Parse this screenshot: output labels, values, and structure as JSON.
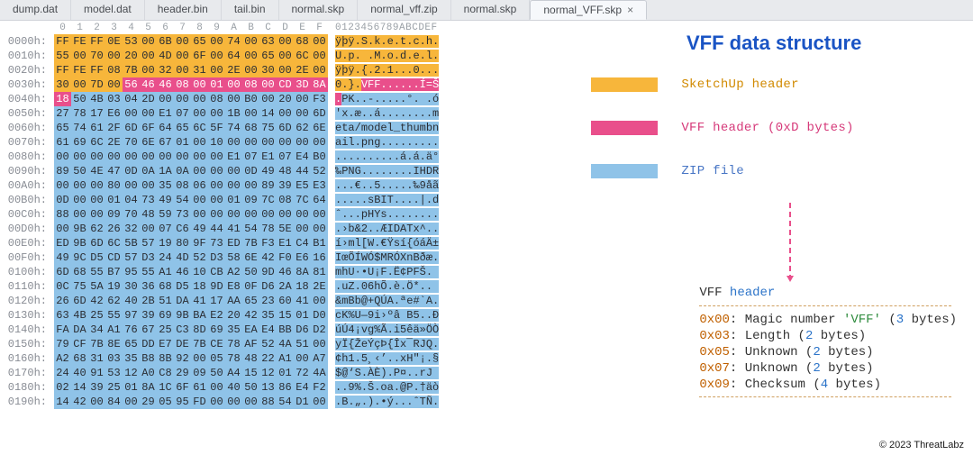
{
  "colors": {
    "sketchup": "#f7b63b",
    "vff": "#e94f8b",
    "zip": "#8fc3e8"
  },
  "tabs": [
    {
      "label": "dump.dat",
      "active": false
    },
    {
      "label": "model.dat",
      "active": false
    },
    {
      "label": "header.bin",
      "active": false
    },
    {
      "label": "tail.bin",
      "active": false
    },
    {
      "label": "normal.skp",
      "active": false
    },
    {
      "label": "normal_vff.zip",
      "active": false
    },
    {
      "label": "normal.skp",
      "active": false
    },
    {
      "label": "normal_VFF.skp",
      "active": true
    }
  ],
  "hex_header": {
    "byte_cols": [
      "0",
      "1",
      "2",
      "3",
      "4",
      "5",
      "6",
      "7",
      "8",
      "9",
      "A",
      "B",
      "C",
      "D",
      "E",
      "F"
    ],
    "ascii_cols": "0123456789ABCDEF"
  },
  "regions": [
    {
      "name": "sketchup",
      "start": 0,
      "end": 51
    },
    {
      "name": "vff",
      "start": 52,
      "end": 64
    },
    {
      "name": "zip",
      "start": 65,
      "end": 415
    }
  ],
  "hex_rows": [
    {
      "offset": "0000h:",
      "bytes": [
        "FF",
        "FE",
        "FF",
        "0E",
        "53",
        "00",
        "6B",
        "00",
        "65",
        "00",
        "74",
        "00",
        "63",
        "00",
        "68",
        "00"
      ],
      "ascii": "ÿþÿ.S.k.e.t.c.h."
    },
    {
      "offset": "0010h:",
      "bytes": [
        "55",
        "00",
        "70",
        "00",
        "20",
        "00",
        "4D",
        "00",
        "6F",
        "00",
        "64",
        "00",
        "65",
        "00",
        "6C",
        "00"
      ],
      "ascii": "U.p. .M.o.d.e.l."
    },
    {
      "offset": "0020h:",
      "bytes": [
        "FF",
        "FE",
        "FF",
        "08",
        "7B",
        "00",
        "32",
        "00",
        "31",
        "00",
        "2E",
        "00",
        "30",
        "00",
        "2E",
        "00"
      ],
      "ascii": "ÿþÿ.{.2.1...0..."
    },
    {
      "offset": "0030h:",
      "bytes": [
        "30",
        "00",
        "7D",
        "00",
        "56",
        "46",
        "46",
        "08",
        "00",
        "01",
        "00",
        "08",
        "00",
        "CD",
        "3D",
        "8A"
      ],
      "ascii": "0.}.VFF......Í=Š"
    },
    {
      "offset": "0040h:",
      "bytes": [
        "18",
        "50",
        "4B",
        "03",
        "04",
        "2D",
        "00",
        "00",
        "00",
        "08",
        "00",
        "B0",
        "00",
        "20",
        "00",
        "F3"
      ],
      "ascii": ".PK..-.....°. .ó"
    },
    {
      "offset": "0050h:",
      "bytes": [
        "27",
        "78",
        "17",
        "E6",
        "00",
        "00",
        "E1",
        "07",
        "00",
        "00",
        "1B",
        "00",
        "14",
        "00",
        "00",
        "6D"
      ],
      "ascii": "'x.æ..á........m"
    },
    {
      "offset": "0060h:",
      "bytes": [
        "65",
        "74",
        "61",
        "2F",
        "6D",
        "6F",
        "64",
        "65",
        "6C",
        "5F",
        "74",
        "68",
        "75",
        "6D",
        "62",
        "6E"
      ],
      "ascii": "eta/model_thumbn"
    },
    {
      "offset": "0070h:",
      "bytes": [
        "61",
        "69",
        "6C",
        "2E",
        "70",
        "6E",
        "67",
        "01",
        "00",
        "10",
        "00",
        "00",
        "00",
        "00",
        "00",
        "00"
      ],
      "ascii": "ail.png........."
    },
    {
      "offset": "0080h:",
      "bytes": [
        "00",
        "00",
        "00",
        "00",
        "00",
        "00",
        "00",
        "00",
        "00",
        "00",
        "E1",
        "07",
        "E1",
        "07",
        "E4",
        "B0"
      ],
      "ascii": "..........á.á.ä°"
    },
    {
      "offset": "0090h:",
      "bytes": [
        "89",
        "50",
        "4E",
        "47",
        "0D",
        "0A",
        "1A",
        "0A",
        "00",
        "00",
        "00",
        "0D",
        "49",
        "48",
        "44",
        "52"
      ],
      "ascii": "‰PNG........IHDR"
    },
    {
      "offset": "00A0h:",
      "bytes": [
        "00",
        "00",
        "00",
        "80",
        "00",
        "00",
        "35",
        "08",
        "06",
        "00",
        "00",
        "00",
        "89",
        "39",
        "E5",
        "E3"
      ],
      "ascii": "...€..5.....‰9åã"
    },
    {
      "offset": "00B0h:",
      "bytes": [
        "0D",
        "00",
        "00",
        "01",
        "04",
        "73",
        "49",
        "54",
        "00",
        "00",
        "01",
        "09",
        "7C",
        "08",
        "7C",
        "64"
      ],
      "ascii": ".....sBIT....|.d"
    },
    {
      "offset": "00C0h:",
      "bytes": [
        "88",
        "00",
        "00",
        "09",
        "70",
        "48",
        "59",
        "73",
        "00",
        "00",
        "00",
        "00",
        "00",
        "00",
        "00",
        "00"
      ],
      "ascii": "ˆ...pHYs........"
    },
    {
      "offset": "00D0h:",
      "bytes": [
        "00",
        "9B",
        "62",
        "26",
        "32",
        "00",
        "07",
        "C6",
        "49",
        "44",
        "41",
        "54",
        "78",
        "5E",
        "00",
        "00"
      ],
      "ascii": ".›b&2..ÆIDATx^.."
    },
    {
      "offset": "00E0h:",
      "bytes": [
        "ED",
        "9B",
        "6D",
        "6C",
        "5B",
        "57",
        "19",
        "80",
        "9F",
        "73",
        "ED",
        "7B",
        "F3",
        "E1",
        "C4",
        "B1"
      ],
      "ascii": "í›ml[W.€Ÿsí{óáÄ±"
    },
    {
      "offset": "00F0h:",
      "bytes": [
        "49",
        "9C",
        "D5",
        "CD",
        "57",
        "D3",
        "24",
        "4D",
        "52",
        "D3",
        "58",
        "6E",
        "42",
        "F0",
        "E6",
        "16"
      ],
      "ascii": "IœÕÍWÓ$MRÓXnBðæ."
    },
    {
      "offset": "0100h:",
      "bytes": [
        "6D",
        "68",
        "55",
        "B7",
        "95",
        "55",
        "A1",
        "46",
        "10",
        "CB",
        "A2",
        "50",
        "9D",
        "46",
        "8A",
        "81"
      ],
      "ascii": "mhU·•U¡F.Ë¢PFŠ."
    },
    {
      "offset": "0110h:",
      "bytes": [
        "0C",
        "75",
        "5A",
        "19",
        "30",
        "36",
        "68",
        "D5",
        "18",
        "9D",
        "E8",
        "0F",
        "D6",
        "2A",
        "18",
        "2E"
      ],
      "ascii": ".uZ.06hÕ.è.Ö*.."
    },
    {
      "offset": "0120h:",
      "bytes": [
        "26",
        "6D",
        "42",
        "62",
        "40",
        "2B",
        "51",
        "DA",
        "41",
        "17",
        "AA",
        "65",
        "23",
        "60",
        "41",
        "00"
      ],
      "ascii": "&mBb@+QÚA.ªe#`A."
    },
    {
      "offset": "0130h:",
      "bytes": [
        "63",
        "4B",
        "25",
        "55",
        "97",
        "39",
        "69",
        "9B",
        "BA",
        "E2",
        "20",
        "42",
        "35",
        "15",
        "01",
        "D0"
      ],
      "ascii": "cK%U—9i›ºâ B5..Ð"
    },
    {
      "offset": "0140h:",
      "bytes": [
        "FA",
        "DA",
        "34",
        "A1",
        "76",
        "67",
        "25",
        "C3",
        "8D",
        "69",
        "35",
        "EA",
        "E4",
        "BB",
        "D6",
        "D2"
      ],
      "ascii": "úÚ4¡vg%Ã.i5êä»ÖÒ"
    },
    {
      "offset": "0150h:",
      "bytes": [
        "79",
        "CF",
        "7B",
        "8E",
        "65",
        "DD",
        "E7",
        "DE",
        "7B",
        "CE",
        "78",
        "AF",
        "52",
        "4A",
        "51",
        "00"
      ],
      "ascii": "yÏ{ŽeÝçÞ{Îx¯RJQ."
    },
    {
      "offset": "0160h:",
      "bytes": [
        "A2",
        "68",
        "31",
        "03",
        "35",
        "B8",
        "8B",
        "92",
        "00",
        "05",
        "78",
        "48",
        "22",
        "A1",
        "00",
        "A7"
      ],
      "ascii": "¢h1.5¸‹’..xH\"¡.§"
    },
    {
      "offset": "0170h:",
      "bytes": [
        "24",
        "40",
        "91",
        "53",
        "12",
        "A0",
        "C8",
        "29",
        "09",
        "50",
        "A4",
        "15",
        "12",
        "01",
        "72",
        "4A"
      ],
      "ascii": "$@‘S.ÀÈ).P¤..rJ"
    },
    {
      "offset": "0180h:",
      "bytes": [
        "02",
        "14",
        "39",
        "25",
        "01",
        "8A",
        "1C",
        "6F",
        "61",
        "00",
        "40",
        "50",
        "13",
        "86",
        "E4",
        "F2"
      ],
      "ascii": "..9%.Š.oa.@P.†äò"
    },
    {
      "offset": "0190h:",
      "bytes": [
        "14",
        "42",
        "00",
        "84",
        "00",
        "29",
        "05",
        "95",
        "FD",
        "00",
        "00",
        "00",
        "88",
        "54",
        "D1",
        "00"
      ],
      "ascii": ".B.„.).•ý...ˆTÑ."
    }
  ],
  "info_panel": {
    "title": "VFF data structure",
    "legend": [
      {
        "swatch_color": "#f7b63b",
        "label": "SketchUp header",
        "class": "lg-orange"
      },
      {
        "swatch_color": "#e94f8b",
        "label": "VFF header (0xD bytes)",
        "class": "lg-pink"
      },
      {
        "swatch_color": "#8fc3e8",
        "label": "ZIP file",
        "class": "lg-blue"
      }
    ],
    "vff_detail_title_plain": "VFF ",
    "vff_detail_title_kw": "header",
    "fields": [
      {
        "addr": "0x00",
        "desc_pre": ": Magic number ",
        "str": "'VFF'",
        "desc_mid": " (",
        "num": "3",
        "desc_post": " bytes)"
      },
      {
        "addr": "0x03",
        "desc_pre": ": Length (",
        "str": "",
        "desc_mid": "",
        "num": "2",
        "desc_post": " bytes)"
      },
      {
        "addr": "0x05",
        "desc_pre": ": Unknown (",
        "str": "",
        "desc_mid": "",
        "num": "2",
        "desc_post": " bytes)"
      },
      {
        "addr": "0x07",
        "desc_pre": ": Unknown (",
        "str": "",
        "desc_mid": "",
        "num": "2",
        "desc_post": " bytes)"
      },
      {
        "addr": "0x09",
        "desc_pre": ": Checksum (",
        "str": "",
        "desc_mid": "",
        "num": "4",
        "desc_post": " bytes)"
      }
    ]
  },
  "copyright": "© 2023 ThreatLabz"
}
